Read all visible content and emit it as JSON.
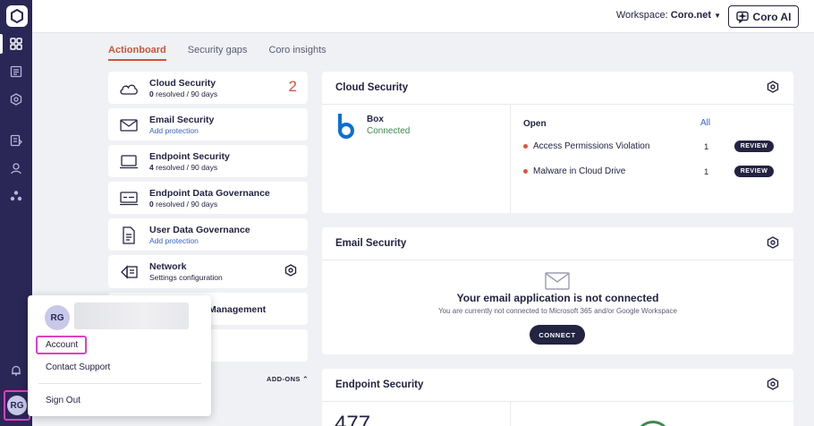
{
  "topbar": {
    "workspace_label": "Workspace:",
    "workspace_name": "Coro.net",
    "ai_button": "Coro AI"
  },
  "tabs": [
    {
      "label": "Actionboard",
      "active": true
    },
    {
      "label": "Security gaps",
      "active": false
    },
    {
      "label": "Coro insights",
      "active": false
    }
  ],
  "left_cards": [
    {
      "title": "Cloud Security",
      "sub_bold": "0",
      "sub": "resolved / 90 days",
      "count": "2",
      "icon": "cloud-icon"
    },
    {
      "title": "Email Security",
      "sub": "Add protection",
      "icon": "envelope-icon"
    },
    {
      "title": "Endpoint Security",
      "sub_bold": "4",
      "sub": "resolved / 90 days",
      "icon": "laptop-icon"
    },
    {
      "title": "Endpoint Data Governance",
      "sub_bold": "0",
      "sub": "resolved / 90 days",
      "icon": "monitor-data-icon"
    },
    {
      "title": "User Data Governance",
      "sub": "Add protection",
      "icon": "document-icon"
    },
    {
      "title": "Network",
      "sub": "Settings configuration",
      "icon": "network-icon"
    }
  ],
  "partial_card_title": "Management",
  "addons_label": "ADD-ONS",
  "cloud_panel": {
    "title": "Cloud Security",
    "app_name": "Box",
    "app_status": "Connected",
    "open_label": "Open",
    "all_label": "All",
    "issues": [
      {
        "label": "Access Permissions Violation",
        "count": "1",
        "action": "REVIEW"
      },
      {
        "label": "Malware in Cloud Drive",
        "count": "1",
        "action": "REVIEW"
      }
    ]
  },
  "email_panel": {
    "title": "Email Security",
    "heading": "Your email application is not connected",
    "subtext": "You are currently not connected to Microsoft 365 and/or Google Workspace",
    "button": "CONNECT"
  },
  "endpoint_panel": {
    "title": "Endpoint Security",
    "partial_number": "477"
  },
  "user_menu": {
    "initials": "RG",
    "items": {
      "account": "Account",
      "support": "Contact Support",
      "signout": "Sign Out"
    }
  },
  "sidebar": {
    "avatar_initials": "RG"
  },
  "colors": {
    "sidebar": "#2a2656",
    "accent_orange": "#c8553d",
    "link_blue": "#3b63c4",
    "highlight_pink": "#e040c0",
    "connected_green": "#3d8a4e"
  }
}
